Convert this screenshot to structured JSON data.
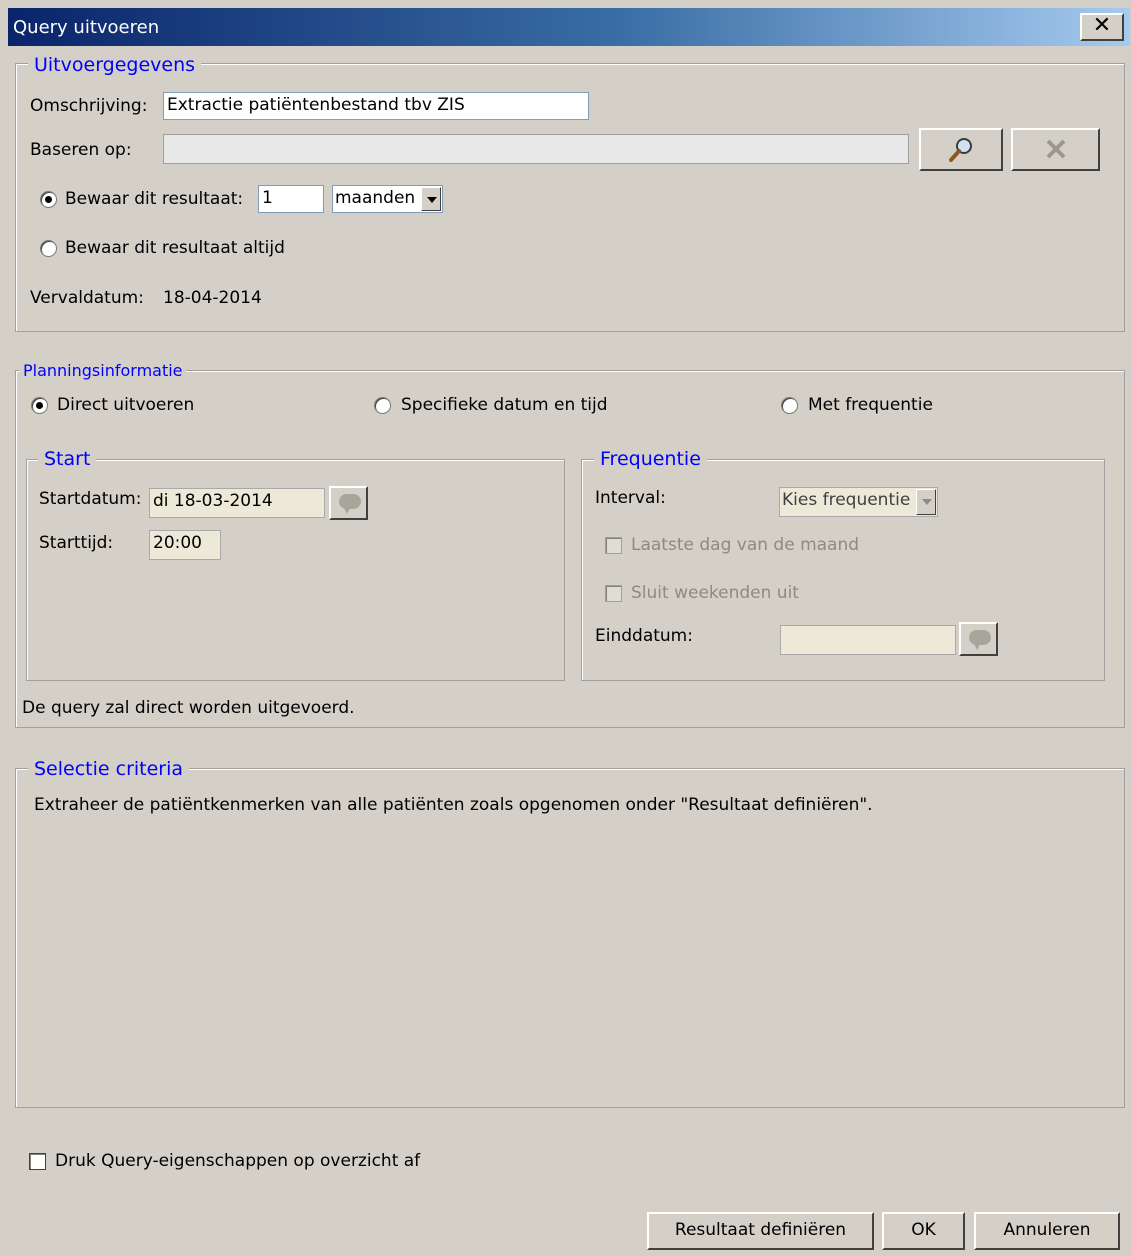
{
  "window": {
    "title": "Query uitvoeren",
    "close_label": "✕"
  },
  "uitvoergegevens": {
    "legend": "Uitvoergegevens",
    "omschrijving_label": "Omschrijving:",
    "omschrijving_value": "Extractie patiëntenbestand tbv ZIS",
    "baseren_label": "Baseren op:",
    "baseren_value": "",
    "bewaar_label": "Bewaar dit resultaat:",
    "bewaar_value": "1",
    "bewaar_unit": "maanden",
    "bewaar_altijd_label": "Bewaar dit resultaat altijd",
    "vervaldatum_label": "Vervaldatum:",
    "vervaldatum_value": "18-04-2014"
  },
  "planning": {
    "legend": "Planningsinformatie",
    "direct_label": "Direct uitvoeren",
    "specifiek_label": "Specifieke datum en tijd",
    "frequentie_label": "Met frequentie",
    "status_text": "De query zal direct worden uitgevoerd.",
    "start": {
      "legend": "Start",
      "startdatum_label": "Startdatum:",
      "startdatum_value": "di 18-03-2014",
      "starttijd_label": "Starttijd:",
      "starttijd_value": "20:00"
    },
    "frequentie": {
      "legend": "Frequentie",
      "interval_label": "Interval:",
      "interval_value": "Kies frequentie",
      "laatste_dag_label": "Laatste dag van de maand",
      "sluit_weekenden_label": "Sluit weekenden uit",
      "einddatum_label": "Einddatum:",
      "einddatum_value": ""
    }
  },
  "selectie": {
    "legend": "Selectie criteria",
    "text": "Extraheer de patiëntkenmerken van alle patiënten zoals opgenomen onder \"Resultaat definiëren\"."
  },
  "footer": {
    "druk_label": "Druk Query-eigenschappen op overzicht af",
    "resultaat_button": "Resultaat definiëren",
    "ok_button": "OK",
    "annuleren_button": "Annuleren"
  }
}
